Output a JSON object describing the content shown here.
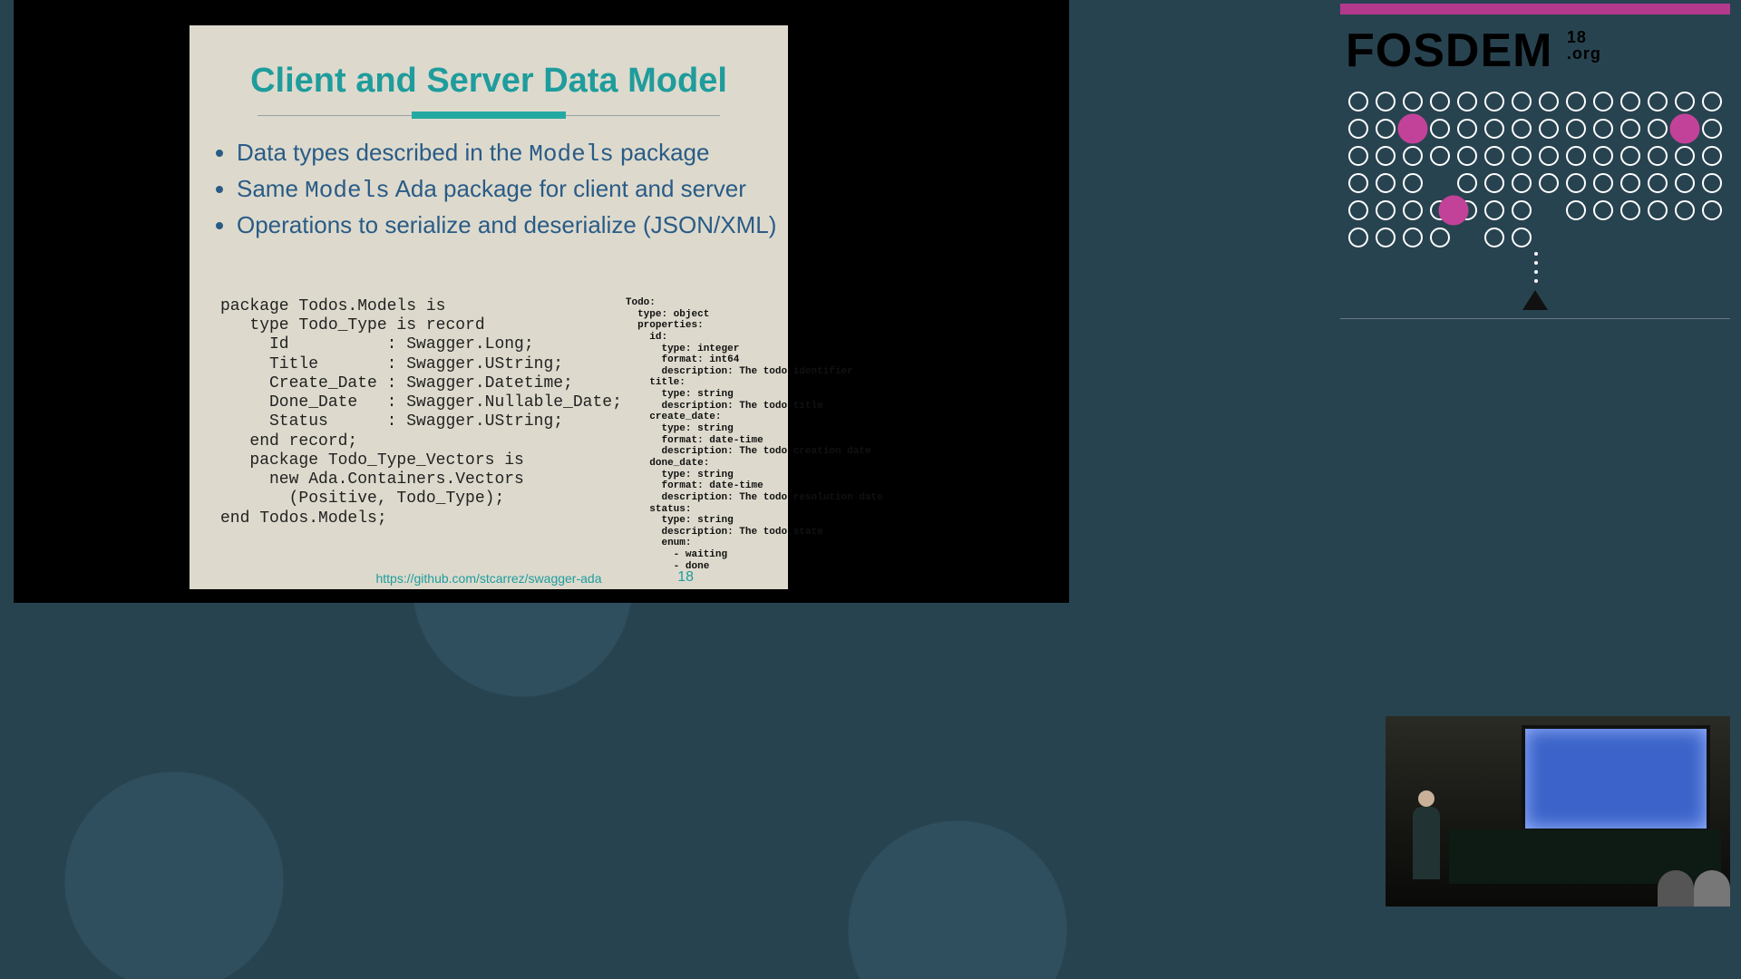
{
  "slide": {
    "title": "Client and Server Data Model",
    "bullets": {
      "b1_pre": "Data types described in the ",
      "b1_mono": "Models",
      "b1_post": " package",
      "b2_pre": "Same ",
      "b2_mono": "Models",
      "b2_post": "  Ada package for client and server",
      "b3": "Operations to serialize and deserialize (JSON/XML)"
    },
    "ada_code": "package Todos.Models is\n   type Todo_Type is record\n     Id          : Swagger.Long;\n     Title       : Swagger.UString;\n     Create_Date : Swagger.Datetime;\n     Done_Date   : Swagger.Nullable_Date;\n     Status      : Swagger.UString;\n   end record;\n   package Todo_Type_Vectors is\n     new Ada.Containers.Vectors\n       (Positive, Todo_Type);\nend Todos.Models;",
    "yaml_code": "Todo:\n  type: object\n  properties:\n    id:\n      type: integer\n      format: int64\n      description: The todo identifier\n    title:\n      type: string\n      description: The todo title\n    create_date:\n      type: string\n      format: date-time\n      description: The todo creation date\n    done_date:\n      type: string\n      format: date-time\n      description: The todo resolution date\n    status:\n      type: string\n      description: The todo state\n      enum:\n        - waiting\n        - done",
    "footer_link": "https://github.com/stcarrez/swagger-ada",
    "page": "18"
  },
  "brand": {
    "name": "FOSDEM",
    "year": "18",
    "domain": ".org",
    "accent": "#c34299"
  }
}
